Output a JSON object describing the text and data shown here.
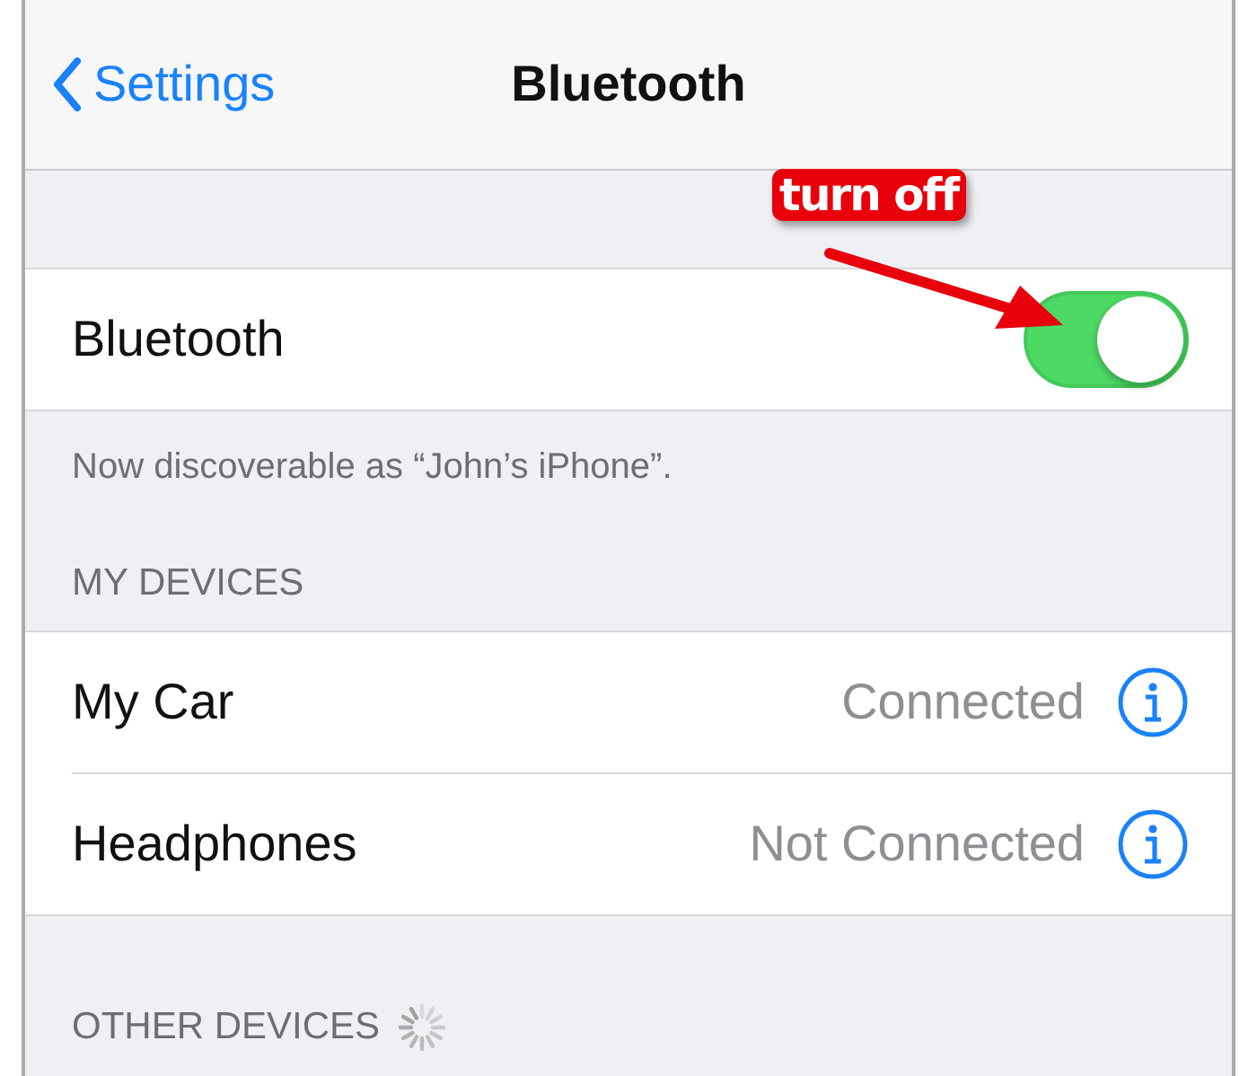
{
  "nav": {
    "back_label": "Settings",
    "title": "Bluetooth"
  },
  "annotation": {
    "text": "turn off"
  },
  "bluetooth": {
    "label": "Bluetooth",
    "on": true
  },
  "footer": "Now discoverable as “John’s iPhone”.",
  "my_devices": {
    "header": "MY DEVICES",
    "devices": [
      {
        "name": "My Car",
        "status": "Connected"
      },
      {
        "name": "Headphones",
        "status": "Not Connected"
      }
    ]
  },
  "other_devices": {
    "header": "OTHER DEVICES",
    "searching": true
  }
}
